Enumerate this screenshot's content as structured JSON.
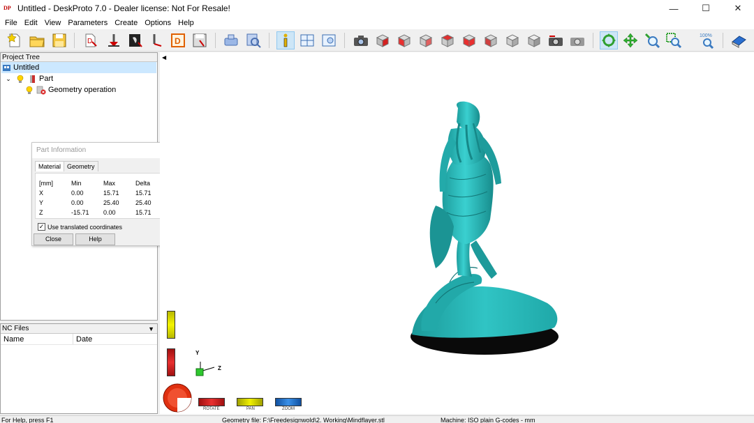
{
  "window": {
    "title": "Untitled - DeskProto 7.0 - Dealer license: Not For Resale!",
    "app_icon_text": "DP",
    "minimize": "—",
    "maximize": "☐",
    "close": "✕"
  },
  "menu": [
    "File",
    "Edit",
    "View",
    "Parameters",
    "Create",
    "Options",
    "Help"
  ],
  "project_tree": {
    "header": "Project Tree",
    "root": "Untitled",
    "part": "Part",
    "operation": "Geometry operation"
  },
  "nc_files": {
    "header": "NC Files",
    "columns": [
      "Name",
      "Date"
    ]
  },
  "part_info": {
    "title": "Part Information",
    "tabs": [
      "Material",
      "Geometry"
    ],
    "columns": [
      "[mm]",
      "Min",
      "Max",
      "Delta"
    ],
    "rows": [
      {
        "axis": "X",
        "min": "0.00",
        "max": "15.71",
        "delta": "15.71"
      },
      {
        "axis": "Y",
        "min": "0.00",
        "max": "25.40",
        "delta": "25.40"
      },
      {
        "axis": "Z",
        "min": "-15.71",
        "max": "0.00",
        "delta": "15.71"
      }
    ],
    "checkbox_label": "Use translated coordinates",
    "checkbox_checked": true,
    "close_button": "Close",
    "help_button": "Help"
  },
  "viewport": {
    "model_color": "#28b8b8",
    "axis_y": "Y",
    "axis_z": "Z",
    "bottom_labels": [
      "ROTATE",
      "PAN",
      "ZOOM"
    ],
    "toolbar_zoom_label": "100%"
  },
  "status": {
    "help": "For Help, press F1",
    "geometry_file": "Geometry file: F:\\Freedesignwold\\2. Working\\Mindflayer.stl",
    "machine": "Machine: ISO plain G-codes - mm"
  }
}
